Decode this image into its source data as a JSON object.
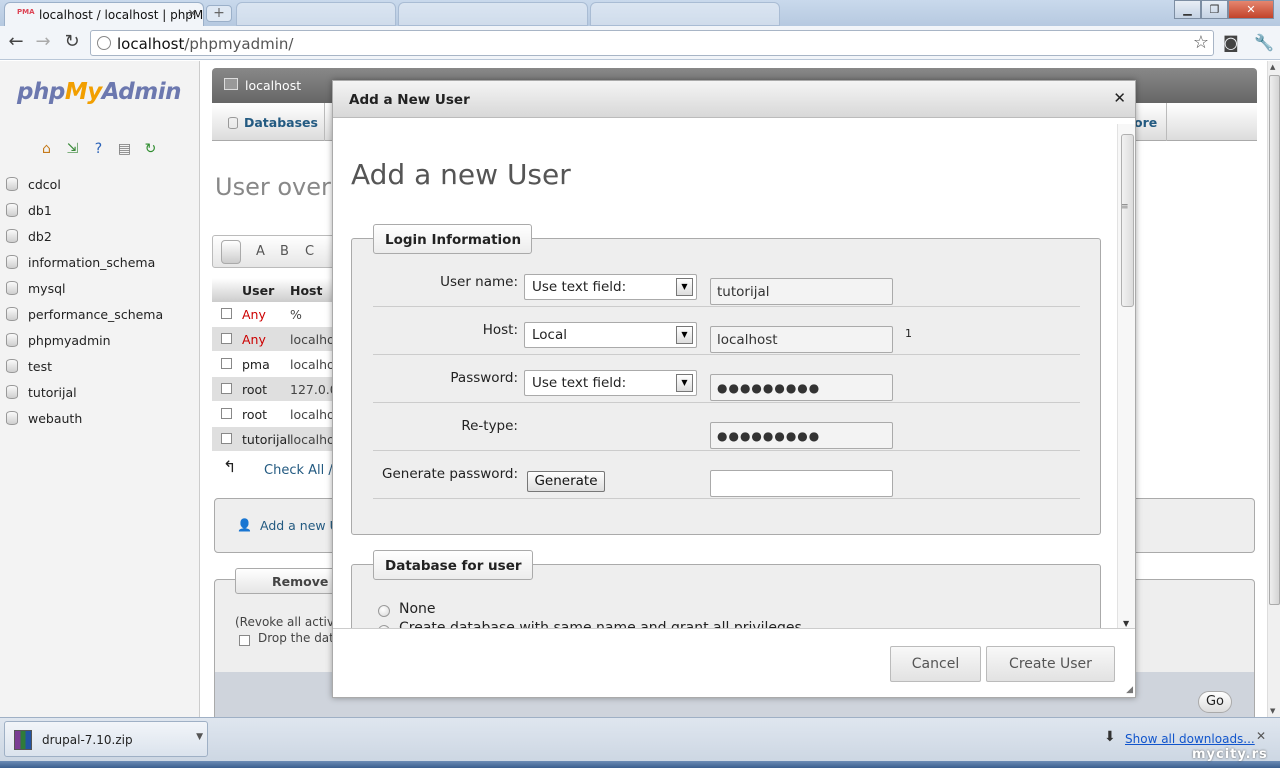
{
  "browser": {
    "active_tab_title": "localhost / localhost | phpMyAdmin",
    "favicon_text": "PMA",
    "url_host": "localhost",
    "url_path": "/phpmyadmin/"
  },
  "pma": {
    "logo": {
      "php": "php",
      "my": "My",
      "admin": "Admin"
    },
    "databases": [
      "cdcol",
      "db1",
      "db2",
      "information_schema",
      "mysql",
      "performance_schema",
      "phpmyadmin",
      "test",
      "tutorijal",
      "webauth"
    ],
    "server_label": "localhost",
    "tab_databases": "Databases",
    "tab_more": "ore",
    "page_title": "User over",
    "alpha_letters": [
      "A",
      "B",
      "C"
    ],
    "table": {
      "headers": [
        "User",
        "Host"
      ],
      "rows": [
        {
          "user": "Any",
          "host": "%"
        },
        {
          "user": "Any",
          "host": "localho"
        },
        {
          "user": "pma",
          "host": "localho"
        },
        {
          "user": "root",
          "host": "127.0.0"
        },
        {
          "user": "root",
          "host": "localho"
        },
        {
          "user": "tutorijal",
          "host": "localho"
        }
      ]
    },
    "check_all": "Check All /",
    "add_user_link": "Add a new U",
    "remove_legend": "Remove s",
    "revoke_text": "(Revoke all activ",
    "drop_text": "Drop the data",
    "go_button": "Go"
  },
  "dialog": {
    "title": "Add a New User",
    "heading": "Add a new User",
    "login_legend": "Login Information",
    "username_label": "User name:",
    "username_select": "Use text field:",
    "username_value": "tutorijal",
    "host_label": "Host:",
    "host_select": "Local",
    "host_value": "localhost",
    "host_sup": "1",
    "password_label": "Password:",
    "password_select": "Use text field:",
    "password_value": "●●●●●●●●●",
    "retype_label": "Re-type:",
    "retype_value": "●●●●●●●●●",
    "generate_label": "Generate password:",
    "generate_button": "Generate",
    "generate_value": "",
    "db_legend": "Database for user",
    "radio_none": "None",
    "radio_create": "Create database with same name and grant all privileges",
    "cancel_button": "Cancel",
    "create_button": "Create User"
  },
  "downloads": {
    "file_name": "drupal-7.10.zip",
    "show_all": "Show all downloads..."
  },
  "watermark": "mycity.rs"
}
